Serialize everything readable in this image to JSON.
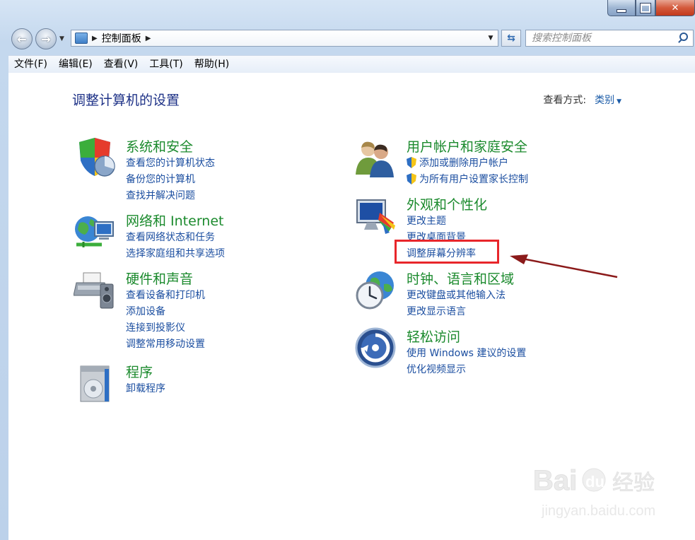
{
  "window": {
    "address": {
      "path": [
        "控制面板"
      ],
      "separator": "▶"
    },
    "search_placeholder": "搜索控制面板"
  },
  "menu": [
    "文件(F)",
    "编辑(E)",
    "查看(V)",
    "工具(T)",
    "帮助(H)"
  ],
  "page": {
    "title": "调整计算机的设置",
    "view_by_label": "查看方式:",
    "view_by_value": "类别"
  },
  "categories": [
    {
      "title": "系统和安全",
      "icon": "shield-chart-icon",
      "links": [
        "查看您的计算机状态",
        "备份您的计算机",
        "查找并解决问题"
      ]
    },
    {
      "title": "网络和 Internet",
      "icon": "network-globe-icon",
      "links": [
        "查看网络状态和任务",
        "选择家庭组和共享选项"
      ]
    },
    {
      "title": "硬件和声音",
      "icon": "printer-speaker-icon",
      "links": [
        "查看设备和打印机",
        "添加设备",
        "连接到投影仪",
        "调整常用移动设置"
      ]
    },
    {
      "title": "程序",
      "icon": "program-disc-icon",
      "links": [
        "卸载程序"
      ]
    },
    {
      "title": "用户帐户和家庭安全",
      "icon": "users-icon",
      "links": [
        "添加或删除用户帐户",
        "为所有用户设置家长控制"
      ]
    },
    {
      "title": "外观和个性化",
      "icon": "monitor-palette-icon",
      "links": [
        "更改主题",
        "更改桌面背景",
        "调整屏幕分辨率"
      ]
    },
    {
      "title": "时钟、语言和区域",
      "icon": "clock-globe-icon",
      "links": [
        "更改键盘或其他输入法",
        "更改显示语言"
      ]
    },
    {
      "title": "轻松访问",
      "icon": "ease-of-access-icon",
      "links": [
        "使用 Windows 建议的设置",
        "优化视频显示"
      ]
    }
  ],
  "colors": {
    "category_title": "#1b8a2d",
    "link": "#1b4ea0",
    "page_title": "#1e3287",
    "highlight": "#e8262b",
    "arrow": "#8b1a1a"
  },
  "watermark": {
    "brand_a": "Bai",
    "brand_b": "du",
    "brand_c": "经验",
    "url": "jingyan.baidu.com"
  }
}
